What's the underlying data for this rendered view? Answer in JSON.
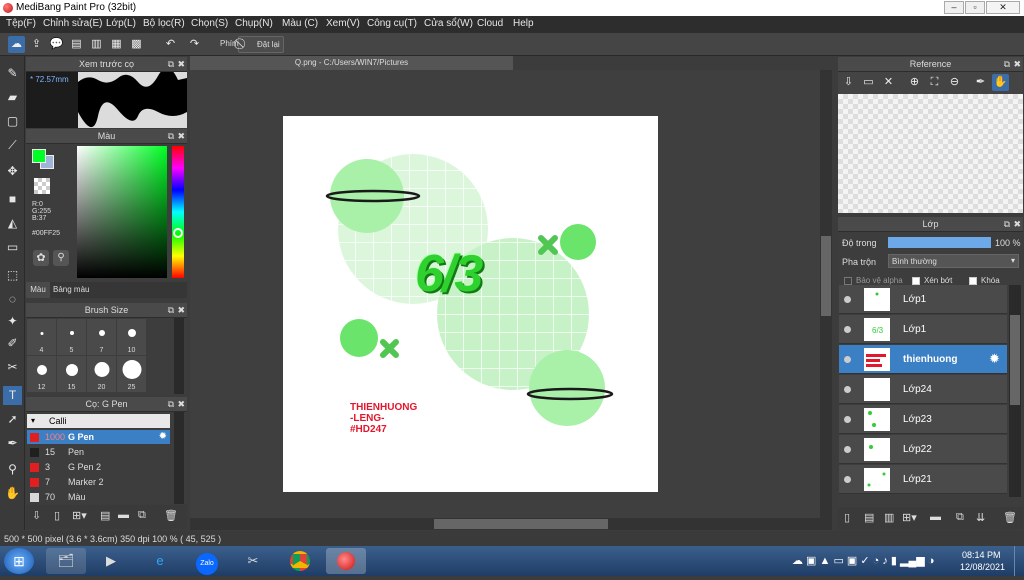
{
  "window": {
    "title": "MediBang Paint Pro (32bit)",
    "min": "▭",
    "max": "▭",
    "close": "✕"
  },
  "menu": [
    "Tệp(F)",
    "Chỉnh sửa(E)",
    "Lớp(L)",
    "Bộ lọc(R)",
    "Chọn(S)",
    "Chụp(N)",
    "Màu (C)",
    "Xem(V)",
    "Công cụ(T)",
    "Cửa sổ(W)",
    "Cloud",
    "Help"
  ],
  "toolbar": {
    "brush_label": "Phím",
    "reset_label": "Đặt lại"
  },
  "preview": {
    "title": "Xem trước cọ",
    "size": "* 72.57mm"
  },
  "color": {
    "title": "Màu",
    "r": "R:0",
    "g": "G:255",
    "b": "B:37",
    "hex": "#00FF25",
    "tab_color": "Màu",
    "tab_palette": "Bảng màu",
    "primary": "#00ff25",
    "secondary": "#9fb4d6"
  },
  "brushsize": {
    "title": "Brush Size",
    "sizes": [
      "4",
      "5",
      "7",
      "10",
      "12",
      "15",
      "20",
      "25"
    ]
  },
  "brushes": {
    "title": "Cọ: G Pen",
    "group": "Calli",
    "items": [
      {
        "n": "1000",
        "l": "G Pen",
        "c": "#e02020"
      },
      {
        "n": "15",
        "l": "Pen",
        "c": "#202020"
      },
      {
        "n": "3",
        "l": "G Pen 2",
        "c": "#e02020"
      },
      {
        "n": "7",
        "l": "Marker 2",
        "c": "#e02020"
      },
      {
        "n": "70",
        "l": "Màu",
        "c": "#d8d8d8"
      }
    ]
  },
  "document": {
    "tab": "Q.png - C:/Users/WIN7/Pictures"
  },
  "artwork": {
    "main": "6/3",
    "sign1": "THIENHUONG",
    "sign2": "-LENG-",
    "sign3": "#HD247"
  },
  "reference": {
    "title": "Reference"
  },
  "layers": {
    "title": "Lớp",
    "opacity_label": "Độ trong",
    "opacity_value": "100 %",
    "opacity": 1.0,
    "blend_label": "Pha trộn",
    "blend_value": "Bình thường",
    "protect_alpha": "Bảo vệ alpha",
    "clip": "Xén bớt",
    "lock": "Khóa",
    "items": [
      "Lớp1",
      "Lớp1",
      "thienhuong",
      "Lớp24",
      "Lớp23",
      "Lớp22",
      "Lớp21"
    ]
  },
  "status": {
    "text": "500 * 500 pixel   (3.6 * 3.6cm)   350 dpi   100 %   ( 45, 525 )"
  },
  "taskbar": {
    "time": "08:14 PM",
    "date": "12/08/2021",
    "zalo": "Zalo"
  }
}
